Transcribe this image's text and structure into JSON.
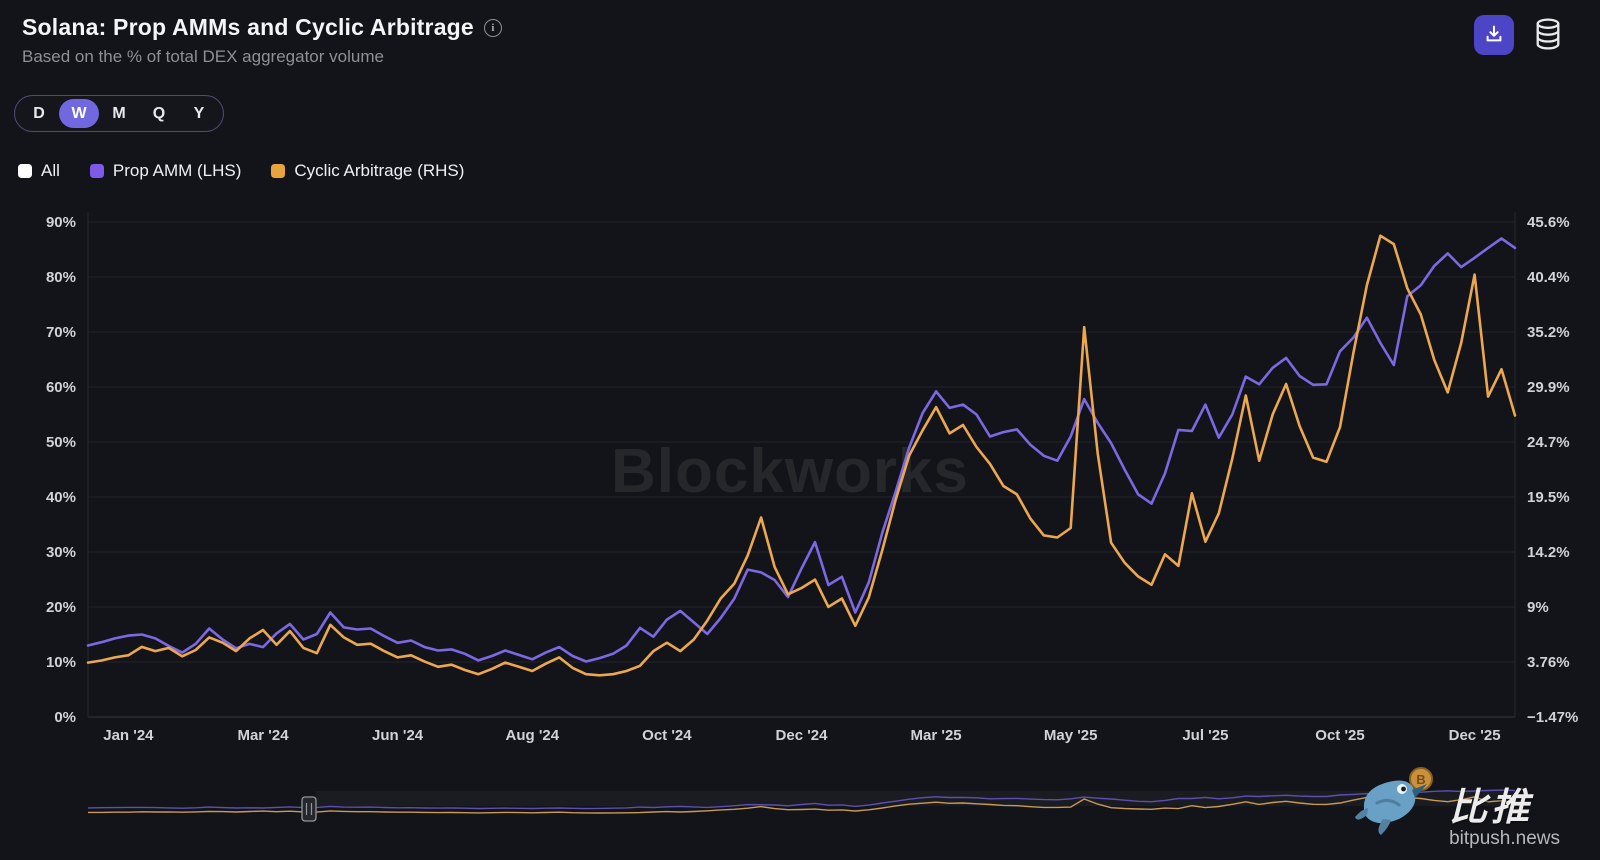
{
  "header": {
    "title": "Solana: Prop AMMs and Cyclic Arbitrage",
    "subtitle": "Based on the % of total DEX aggregator volume",
    "info_icon_glyph": "i"
  },
  "toolbar": {
    "download_icon": "download-tray-arrow-icon",
    "data_source_icon": "database-cylinder-icon"
  },
  "range_toggle": {
    "options": [
      "D",
      "W",
      "M",
      "Q",
      "Y"
    ],
    "selected": "W"
  },
  "legend": [
    {
      "label": "All",
      "color": "#ffffff"
    },
    {
      "label": "Prop AMM (LHS)",
      "color": "#7d5be8"
    },
    {
      "label": "Cyclic Arbitrage (RHS)",
      "color": "#e7a33c"
    }
  ],
  "watermark": "Blockworks",
  "branding": {
    "logo": "bitpush-bird-logo",
    "name_cn": "比推",
    "site": "bitpush.news"
  },
  "chart_data": {
    "type": "line",
    "x_tick_labels": [
      "Jan '24",
      "Mar '24",
      "Jun '24",
      "Aug '24",
      "Oct '24",
      "Dec '24",
      "Mar '25",
      "May '25",
      "Jul '25",
      "Oct '25",
      "Dec '25"
    ],
    "left_axis": {
      "unit": "%",
      "min": 0,
      "max": 90,
      "labels": [
        "90%",
        "80%",
        "70%",
        "60%",
        "50%",
        "40%",
        "30%",
        "20%",
        "10%",
        "0%"
      ]
    },
    "right_axis": {
      "unit": "%",
      "min": -1.47,
      "max": 45.6,
      "labels": [
        "45.6%",
        "40.4%",
        "35.2%",
        "29.9%",
        "24.7%",
        "19.5%",
        "14.2%",
        "9%",
        "3.76%",
        "−1.47%"
      ]
    },
    "grid": true,
    "legend_position": "top-left",
    "series": [
      {
        "name": "Prop AMM (LHS)",
        "axis": "left",
        "color": "#7c68e2",
        "values": [
          13.0,
          13.6,
          14.3,
          14.8,
          15.0,
          14.3,
          12.9,
          11.7,
          13.3,
          16.1,
          14.1,
          12.5,
          13.3,
          12.7,
          15.2,
          16.9,
          14.1,
          15.1,
          19.0,
          16.3,
          15.9,
          16.1,
          14.7,
          13.5,
          13.9,
          12.7,
          12.1,
          12.3,
          11.5,
          10.3,
          11.1,
          12.1,
          11.3,
          10.5,
          11.7,
          12.7,
          11.1,
          10.1,
          10.7,
          11.5,
          13.0,
          16.2,
          14.6,
          17.7,
          19.3,
          17.2,
          15.1,
          18.0,
          21.5,
          26.8,
          26.3,
          24.9,
          21.8,
          27.0,
          31.8,
          24.0,
          25.5,
          19.0,
          24.5,
          33.5,
          41.0,
          49.0,
          55.3,
          59.2,
          56.2,
          56.8,
          55.0,
          51.0,
          51.8,
          52.3,
          49.5,
          47.5,
          46.6,
          51.0,
          57.8,
          53.5,
          49.8,
          45.0,
          40.5,
          38.8,
          44.3,
          52.2,
          52.0,
          56.8,
          50.8,
          55.0,
          61.9,
          60.5,
          63.5,
          65.3,
          62.0,
          60.4,
          60.5,
          66.5,
          69.0,
          72.6,
          68.0,
          64.0,
          76.5,
          78.5,
          82.0,
          84.3,
          81.8,
          83.5,
          85.3,
          87.0,
          85.3
        ]
      },
      {
        "name": "Cyclic Arbitrage (RHS)",
        "axis": "right",
        "color": "#eca84e",
        "values": [
          3.7,
          3.9,
          4.2,
          4.4,
          5.2,
          4.8,
          5.1,
          4.3,
          4.9,
          6.1,
          5.6,
          4.8,
          6.0,
          6.8,
          5.4,
          6.7,
          5.1,
          4.6,
          7.3,
          6.1,
          5.4,
          5.5,
          4.8,
          4.2,
          4.4,
          3.8,
          3.3,
          3.5,
          3.0,
          2.6,
          3.1,
          3.7,
          3.3,
          2.9,
          3.6,
          4.2,
          3.2,
          2.6,
          2.5,
          2.6,
          2.9,
          3.4,
          4.8,
          5.6,
          4.8,
          5.9,
          7.7,
          9.8,
          11.2,
          13.9,
          17.5,
          12.8,
          10.2,
          10.8,
          11.6,
          9.0,
          9.8,
          7.2,
          9.9,
          14.4,
          19.2,
          23.4,
          25.8,
          28.0,
          25.5,
          26.3,
          24.2,
          22.6,
          20.5,
          19.7,
          17.4,
          15.8,
          15.6,
          16.5,
          35.6,
          23.6,
          15.1,
          13.2,
          11.9,
          11.1,
          14.0,
          12.9,
          19.8,
          15.2,
          17.9,
          23.1,
          29.1,
          22.9,
          27.3,
          30.2,
          26.2,
          23.2,
          22.8,
          26.1,
          33.2,
          39.6,
          44.3,
          43.5,
          39.3,
          36.8,
          32.5,
          29.4,
          34.1,
          40.6,
          29.0,
          31.6,
          27.2
        ]
      }
    ]
  },
  "navigator": {
    "handle_icon": "brush-drag-handle"
  }
}
